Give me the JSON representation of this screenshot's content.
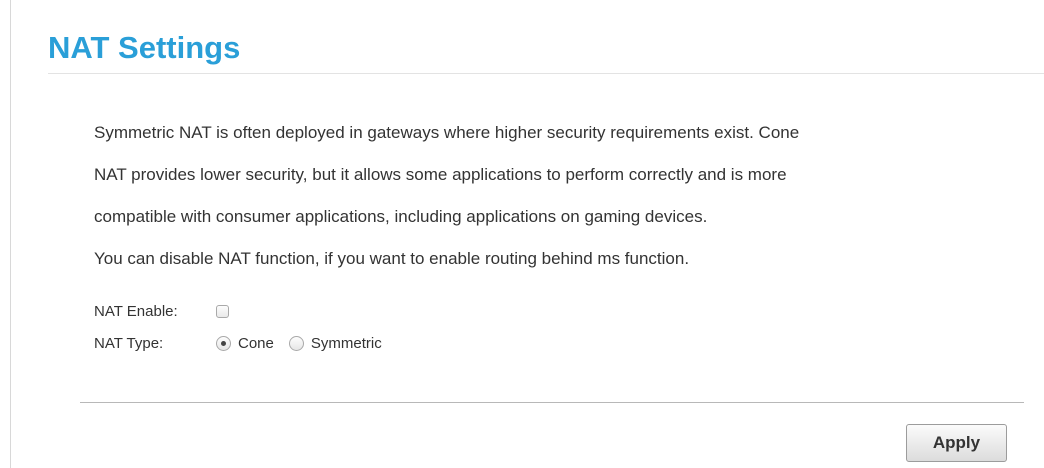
{
  "page": {
    "title": "NAT Settings"
  },
  "description": {
    "lines": [
      "Symmetric NAT is often deployed in gateways where higher security requirements exist. Cone",
      "NAT provides lower security, but it allows some applications to perform correctly and is more",
      "compatible with consumer applications, including applications on gaming devices.",
      "You can disable NAT function, if you want to enable routing behind ms function."
    ]
  },
  "form": {
    "nat_enable": {
      "label": "NAT Enable:",
      "checked": false
    },
    "nat_type": {
      "label": "NAT Type:",
      "selected": "Cone",
      "options": [
        "Cone",
        "Symmetric"
      ]
    }
  },
  "actions": {
    "apply_label": "Apply"
  },
  "colors": {
    "title": "#2a9fd8",
    "text": "#333333"
  }
}
